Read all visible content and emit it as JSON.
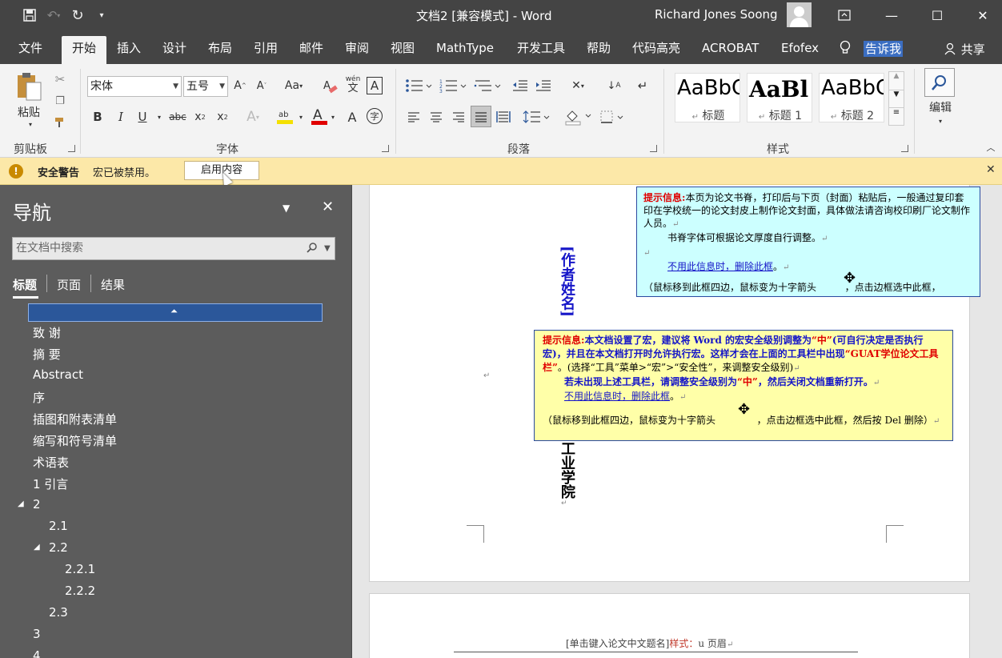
{
  "titlebar": {
    "title": "文档2 [兼容模式] - Word",
    "user": "Richard Jones Soong",
    "qat_icons": [
      "save-icon",
      "undo-icon",
      "redo-icon",
      "customize-icon"
    ],
    "window_controls": [
      "ribbon-display-icon",
      "minimize-icon",
      "maximize-icon",
      "close-icon"
    ]
  },
  "tabs": [
    "文件",
    "开始",
    "插入",
    "设计",
    "布局",
    "引用",
    "邮件",
    "审阅",
    "视图",
    "MathType",
    "开发工具",
    "帮助",
    "代码高亮",
    "ACROBAT",
    "Efofex"
  ],
  "active_tab": "开始",
  "tellme": "告诉我",
  "share": "共享",
  "ribbon": {
    "clipboard": {
      "paste": "粘贴",
      "label": "剪贴板"
    },
    "font": {
      "name": "宋体",
      "size": "五号",
      "label": "字体",
      "change_case": "Aa",
      "phonetic": "wén",
      "phonetic_sub": "文"
    },
    "paragraph": {
      "label": "段落"
    },
    "styles": {
      "label": "样式",
      "items": [
        {
          "sample": "AaBbC",
          "name": "标题"
        },
        {
          "sample": "AaBl",
          "name": "标题 1"
        },
        {
          "sample": "AaBbC",
          "name": "标题 2"
        }
      ]
    },
    "editing": {
      "label": "编辑"
    }
  },
  "security_bar": {
    "title": "安全警告",
    "message": "宏已被禁用。",
    "button": "启用内容"
  },
  "nav": {
    "title": "导航",
    "search_placeholder": "在文档中搜索",
    "tabs": [
      "标题",
      "页面",
      "结果"
    ],
    "items": [
      {
        "label": "致 谢",
        "level": 1
      },
      {
        "label": "摘 要",
        "level": 1
      },
      {
        "label": "Abstract",
        "level": 1
      },
      {
        "label": "序",
        "level": 1
      },
      {
        "label": "插图和附表清单",
        "level": 1
      },
      {
        "label": "缩写和符号清单",
        "level": 1
      },
      {
        "label": "术语表",
        "level": 1
      },
      {
        "label": "1 引言",
        "level": 1
      },
      {
        "label": "2",
        "level": 1,
        "expanded": true
      },
      {
        "label": "2.1",
        "level": 2
      },
      {
        "label": "2.2",
        "level": 2,
        "expanded": true
      },
      {
        "label": "2.2.1",
        "level": 3
      },
      {
        "label": "2.2.2",
        "level": 3
      },
      {
        "label": "2.3",
        "level": 2
      },
      {
        "label": "3",
        "level": 1
      },
      {
        "label": "4",
        "level": 1
      }
    ]
  },
  "document": {
    "spine_author": "[作者姓名]",
    "spine_bottom": "工业学院",
    "cyan_box": {
      "label": "提示信息:",
      "line1": "本页为论文书脊，打印后与下页（封面）粘贴后，一般通过复印套印在学校统一的论文封皮上制作论文封面，具体做法请咨询校印刷厂论文制作人员。",
      "line2": "书脊字体可根据论文厚度自行调整。",
      "link": "不用此信息时，删除此框",
      "line3": "（鼠标移到此框四边，鼠标变为十字箭头",
      "line3b": "，点击边框选中此框，"
    },
    "yellow_box": {
      "label": "提示信息:",
      "p1": "本文档设置了宏，建议将 Word 的宏安全级别调整为",
      "q1": "“中”",
      "p1b": "(可自行决定是否执行宏)，并且在本文档打开时允许执行宏。这样才会在上面的工具栏中出现",
      "q2": "“GUAT学位论文工具栏”",
      "p1c": "。(选择“工具”菜单>“宏”>“安全性”，来调整安全级别)",
      "p2": "若未出现上述工具栏，请调整安全级别为",
      "q3": "“中”",
      "p2b": "，然后关闭文档重新打开。",
      "link": "不用此信息时，删除此框",
      "p3": "（鼠标移到此框四边，鼠标变为十字箭头",
      "p3b": "，点击边框选中此框，然后按 Del 删除）"
    },
    "header": {
      "text": "[单击键入论文中文题名]",
      "style": "样式：",
      "style2": "u 页眉"
    }
  }
}
